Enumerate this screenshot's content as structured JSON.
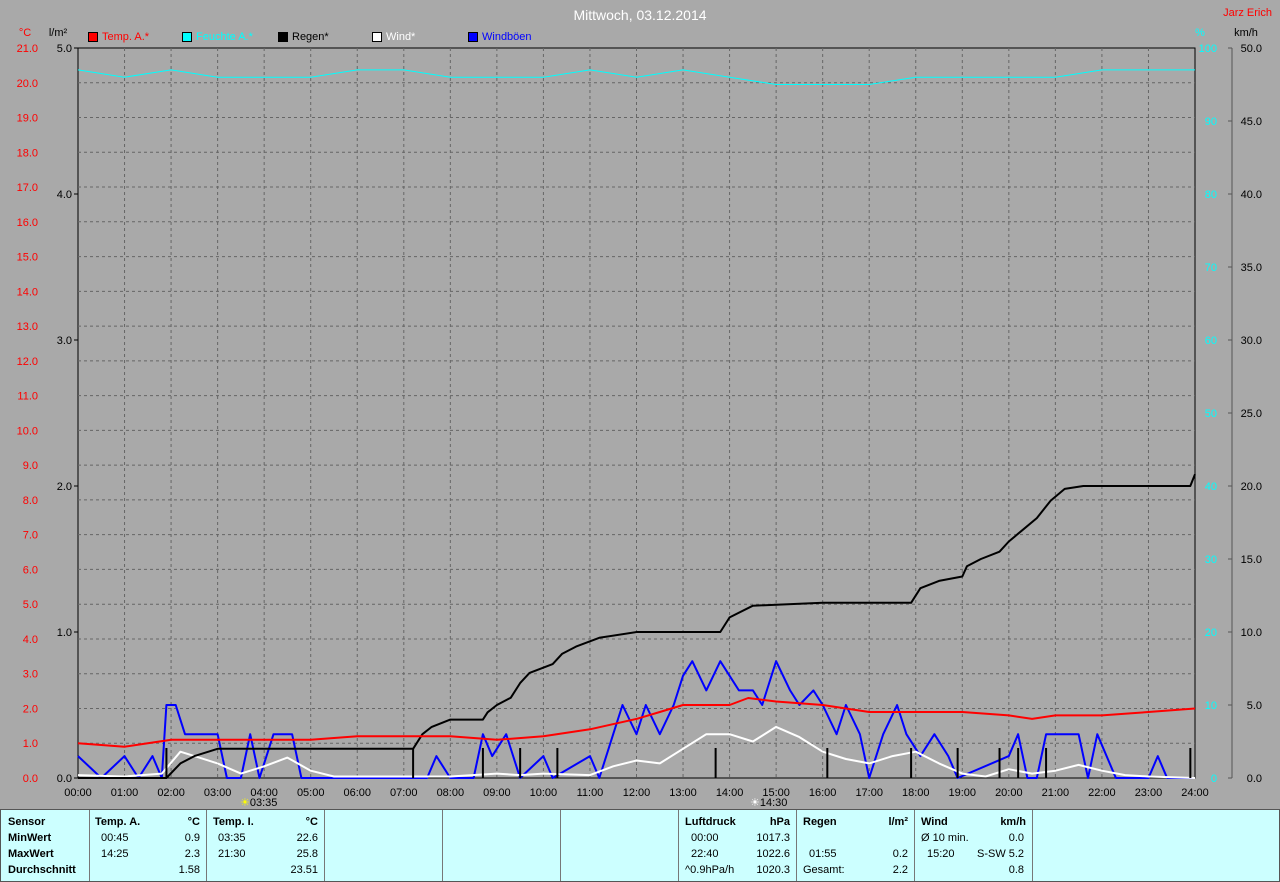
{
  "title": "Mittwoch, 03.12.2014",
  "author": "Jarz Erich",
  "units": {
    "temp": "°C",
    "rain": "l/m²",
    "humidity": "%",
    "wind": "km/h"
  },
  "legend": [
    {
      "label": "Temp. A.*",
      "color": "#ff0000"
    },
    {
      "label": "Feuchte A.*",
      "color": "#00ffff"
    },
    {
      "label": "Regen*",
      "color": "#000000"
    },
    {
      "label": "Wind*",
      "color": "#ffffff"
    },
    {
      "label": "Windböen",
      "color": "#0000ff"
    }
  ],
  "markers": {
    "sunrise": "03:35",
    "sunset": "14:30"
  },
  "chart_data": {
    "type": "line",
    "x_ticks": [
      "00:00",
      "01:00",
      "02:00",
      "03:00",
      "04:00",
      "05:00",
      "06:00",
      "07:00",
      "08:00",
      "09:00",
      "10:00",
      "11:00",
      "12:00",
      "13:00",
      "14:00",
      "15:00",
      "16:00",
      "17:00",
      "18:00",
      "19:00",
      "20:00",
      "21:00",
      "22:00",
      "23:00",
      "24:00"
    ],
    "y_temp_ticks": [
      "0.0",
      "1.0",
      "2.0",
      "3.0",
      "4.0",
      "5.0",
      "6.0",
      "7.0",
      "8.0",
      "9.0",
      "10.0",
      "11.0",
      "12.0",
      "13.0",
      "14.0",
      "15.0",
      "16.0",
      "17.0",
      "18.0",
      "19.0",
      "20.0",
      "21.0"
    ],
    "y_rain_ticks": [
      "0.0",
      "1.0",
      "2.0",
      "3.0",
      "4.0",
      "5.0"
    ],
    "y_hum_ticks": [
      "0",
      "10",
      "20",
      "30",
      "40",
      "50",
      "60",
      "70",
      "80",
      "90",
      "100"
    ],
    "y_wind_ticks": [
      "0.0",
      "5.0",
      "10.0",
      "15.0",
      "20.0",
      "25.0",
      "30.0",
      "35.0",
      "40.0",
      "45.0",
      "50.0"
    ],
    "ylim_temp": [
      0,
      21
    ],
    "ylim_rain": [
      0,
      5
    ],
    "ylim_hum": [
      0,
      100
    ],
    "ylim_wind": [
      0,
      50
    ],
    "series": [
      {
        "name": "Temp. A.*",
        "axis": "temp",
        "color": "#ff0000",
        "points": [
          [
            0,
            1.0
          ],
          [
            1,
            0.9
          ],
          [
            1.5,
            1.0
          ],
          [
            2,
            1.1
          ],
          [
            3,
            1.1
          ],
          [
            4,
            1.1
          ],
          [
            5,
            1.1
          ],
          [
            6,
            1.2
          ],
          [
            7,
            1.2
          ],
          [
            8,
            1.2
          ],
          [
            9,
            1.1
          ],
          [
            10,
            1.2
          ],
          [
            11,
            1.4
          ],
          [
            12,
            1.7
          ],
          [
            12.5,
            1.9
          ],
          [
            13,
            2.1
          ],
          [
            14,
            2.1
          ],
          [
            14.4,
            2.3
          ],
          [
            15,
            2.2
          ],
          [
            16,
            2.1
          ],
          [
            16.5,
            2.0
          ],
          [
            17,
            1.9
          ],
          [
            18,
            1.9
          ],
          [
            19,
            1.9
          ],
          [
            20,
            1.8
          ],
          [
            20.5,
            1.7
          ],
          [
            21,
            1.8
          ],
          [
            22,
            1.8
          ],
          [
            23,
            1.9
          ],
          [
            24,
            2.0
          ]
        ]
      },
      {
        "name": "Feuchte A.*",
        "axis": "hum",
        "color": "#00ffff",
        "points": [
          [
            0,
            97
          ],
          [
            1,
            96
          ],
          [
            2,
            97
          ],
          [
            3,
            96
          ],
          [
            4,
            96
          ],
          [
            5,
            96
          ],
          [
            6,
            97
          ],
          [
            7,
            97
          ],
          [
            8,
            96
          ],
          [
            9,
            96
          ],
          [
            10,
            96
          ],
          [
            11,
            97
          ],
          [
            12,
            96
          ],
          [
            13,
            97
          ],
          [
            14,
            96
          ],
          [
            15,
            95
          ],
          [
            16,
            95
          ],
          [
            17,
            95
          ],
          [
            18,
            96
          ],
          [
            19,
            96
          ],
          [
            20,
            96
          ],
          [
            21,
            96
          ],
          [
            22,
            97
          ],
          [
            23,
            97
          ],
          [
            24,
            97
          ]
        ]
      },
      {
        "name": "Regen*",
        "axis": "rain",
        "color": "#000000",
        "points": [
          [
            0,
            0
          ],
          [
            1.9,
            0
          ],
          [
            2.2,
            0.1
          ],
          [
            2.5,
            0.15
          ],
          [
            3,
            0.2
          ],
          [
            4,
            0.2
          ],
          [
            5,
            0.2
          ],
          [
            6,
            0.2
          ],
          [
            7,
            0.2
          ],
          [
            7.2,
            0.2
          ],
          [
            7.4,
            0.3
          ],
          [
            7.6,
            0.35
          ],
          [
            8,
            0.4
          ],
          [
            8.7,
            0.4
          ],
          [
            8.8,
            0.45
          ],
          [
            9,
            0.5
          ],
          [
            9.3,
            0.55
          ],
          [
            9.5,
            0.65
          ],
          [
            9.7,
            0.72
          ],
          [
            10.2,
            0.78
          ],
          [
            10.4,
            0.85
          ],
          [
            10.7,
            0.9
          ],
          [
            11.2,
            0.96
          ],
          [
            12,
            1.0
          ],
          [
            13.8,
            1.0
          ],
          [
            14,
            1.1
          ],
          [
            14.5,
            1.18
          ],
          [
            16,
            1.2
          ],
          [
            17.9,
            1.2
          ],
          [
            18.1,
            1.3
          ],
          [
            18.5,
            1.35
          ],
          [
            19,
            1.38
          ],
          [
            19.1,
            1.45
          ],
          [
            19.4,
            1.5
          ],
          [
            19.8,
            1.55
          ],
          [
            20,
            1.62
          ],
          [
            20.3,
            1.7
          ],
          [
            20.6,
            1.78
          ],
          [
            20.9,
            1.9
          ],
          [
            21.2,
            1.98
          ],
          [
            21.6,
            2.0
          ],
          [
            23.9,
            2.0
          ],
          [
            24,
            2.08
          ]
        ]
      },
      {
        "name": "Wind*",
        "axis": "wind",
        "color": "#ffffff",
        "points": [
          [
            0,
            0.2
          ],
          [
            1,
            0.1
          ],
          [
            1.8,
            0.3
          ],
          [
            2.2,
            1.8
          ],
          [
            2.5,
            1.5
          ],
          [
            3,
            1.0
          ],
          [
            3.5,
            0.3
          ],
          [
            4,
            0.8
          ],
          [
            4.5,
            1.4
          ],
          [
            5,
            0.5
          ],
          [
            5.5,
            0.1
          ],
          [
            7,
            0.1
          ],
          [
            8,
            0.1
          ],
          [
            9,
            0.3
          ],
          [
            9.5,
            0.2
          ],
          [
            10,
            0.3
          ],
          [
            11,
            0.2
          ],
          [
            11.5,
            0.8
          ],
          [
            12,
            1.2
          ],
          [
            12.5,
            1.0
          ],
          [
            13,
            2.0
          ],
          [
            13.5,
            3.0
          ],
          [
            14,
            3.0
          ],
          [
            14.5,
            2.5
          ],
          [
            15,
            3.5
          ],
          [
            15.5,
            2.8
          ],
          [
            16,
            1.8
          ],
          [
            16.5,
            1.3
          ],
          [
            17,
            1.0
          ],
          [
            17.5,
            1.5
          ],
          [
            18,
            1.8
          ],
          [
            18.5,
            1.0
          ],
          [
            19,
            0.3
          ],
          [
            19.5,
            0.1
          ],
          [
            20,
            0.6
          ],
          [
            20.5,
            0.3
          ],
          [
            21,
            0.5
          ],
          [
            21.5,
            0.9
          ],
          [
            22,
            0.5
          ],
          [
            22.5,
            0.2
          ],
          [
            23,
            0.1
          ],
          [
            24,
            0.0
          ]
        ]
      },
      {
        "name": "Windböen",
        "axis": "wind",
        "color": "#0000ff",
        "points": [
          [
            0,
            1.5
          ],
          [
            0.5,
            0
          ],
          [
            1,
            1.5
          ],
          [
            1.3,
            0
          ],
          [
            1.6,
            1.5
          ],
          [
            1.8,
            0
          ],
          [
            1.9,
            5
          ],
          [
            2.1,
            5
          ],
          [
            2.3,
            3
          ],
          [
            3,
            3
          ],
          [
            3.2,
            0
          ],
          [
            3.5,
            0
          ],
          [
            3.7,
            3
          ],
          [
            3.9,
            0
          ],
          [
            4.2,
            3
          ],
          [
            4.6,
            3
          ],
          [
            4.8,
            0
          ],
          [
            7.5,
            0
          ],
          [
            7.7,
            1.5
          ],
          [
            8,
            0
          ],
          [
            8.5,
            0
          ],
          [
            8.7,
            3
          ],
          [
            8.9,
            1.5
          ],
          [
            9.2,
            3
          ],
          [
            9.5,
            0
          ],
          [
            10,
            1.5
          ],
          [
            10.2,
            0
          ],
          [
            11,
            1.5
          ],
          [
            11.2,
            0
          ],
          [
            11.5,
            3
          ],
          [
            11.7,
            5
          ],
          [
            12,
            3
          ],
          [
            12.2,
            5
          ],
          [
            12.5,
            3
          ],
          [
            12.8,
            5
          ],
          [
            13,
            7
          ],
          [
            13.2,
            8
          ],
          [
            13.5,
            6
          ],
          [
            13.8,
            8
          ],
          [
            14,
            7
          ],
          [
            14.2,
            6
          ],
          [
            14.5,
            6
          ],
          [
            14.7,
            5
          ],
          [
            15,
            8
          ],
          [
            15.3,
            6
          ],
          [
            15.5,
            5
          ],
          [
            15.8,
            6
          ],
          [
            16,
            5
          ],
          [
            16.3,
            3
          ],
          [
            16.5,
            5
          ],
          [
            16.8,
            3
          ],
          [
            17,
            0
          ],
          [
            17.3,
            3
          ],
          [
            17.6,
            5
          ],
          [
            17.8,
            3
          ],
          [
            18.1,
            1.5
          ],
          [
            18.4,
            3
          ],
          [
            18.7,
            1.5
          ],
          [
            18.9,
            0
          ],
          [
            20,
            1.5
          ],
          [
            20.2,
            3
          ],
          [
            20.4,
            0
          ],
          [
            20.6,
            0
          ],
          [
            20.8,
            3
          ],
          [
            21.5,
            3
          ],
          [
            21.7,
            0
          ],
          [
            21.9,
            3
          ],
          [
            22.1,
            1.5
          ],
          [
            22.3,
            0
          ],
          [
            22.5,
            0
          ],
          [
            23,
            0
          ],
          [
            23.2,
            1.5
          ],
          [
            23.4,
            0
          ],
          [
            24,
            0
          ]
        ]
      }
    ],
    "rain_bars": [
      1.9,
      7.2,
      8.7,
      9.5,
      10.3,
      13.7,
      16.1,
      17.9,
      18.9,
      19.8,
      20.2,
      20.8,
      23.9
    ]
  },
  "panel": {
    "sensor": {
      "header": "Sensor",
      "rows": [
        "MinWert",
        "MaxWert",
        "Durchschnitt"
      ]
    },
    "temp_a": {
      "header": "Temp. A.",
      "unit": "°C",
      "times": [
        "00:45",
        "14:25",
        ""
      ],
      "values": [
        "0.9",
        "2.3",
        "1.58"
      ]
    },
    "temp_i": {
      "header": "Temp. I.",
      "unit": "°C",
      "times": [
        "03:35",
        "21:30",
        ""
      ],
      "values": [
        "22.6",
        "25.8",
        "23.51"
      ]
    },
    "luftdruck": {
      "header": "Luftdruck",
      "unit": "hPa",
      "times": [
        "00:00",
        "22:40",
        "^0.9hPa/h"
      ],
      "values": [
        "1017.3",
        "1022.6",
        "1020.3"
      ]
    },
    "regen": {
      "header": "Regen",
      "unit": "l/m²",
      "times": [
        "",
        "01:55",
        "Gesamt:"
      ],
      "values": [
        "",
        "0.2",
        "2.2"
      ]
    },
    "wind": {
      "header": "Wind",
      "unit": "km/h",
      "times": [
        "Ø 10 min.",
        "15:20",
        ""
      ],
      "dir": [
        "",
        "S-SW",
        ""
      ],
      "values": [
        "0.0",
        "5.2",
        "0.8"
      ]
    }
  }
}
